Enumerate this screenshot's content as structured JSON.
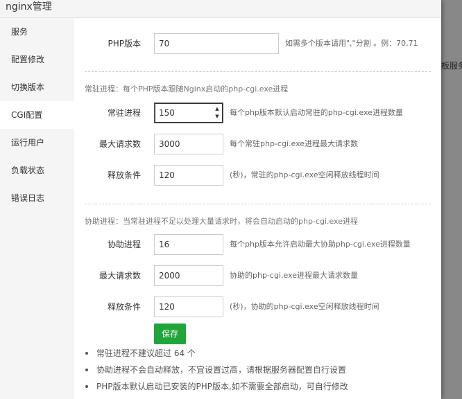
{
  "window": {
    "title": "nginx管理"
  },
  "background": {
    "right_text": "板服务"
  },
  "sidebar": {
    "items": [
      {
        "label": "服务",
        "active": false
      },
      {
        "label": "配置修改",
        "active": false
      },
      {
        "label": "切换版本",
        "active": false
      },
      {
        "label": "CGI配置",
        "active": true
      },
      {
        "label": "运行用户",
        "active": false
      },
      {
        "label": "负载状态",
        "active": false
      },
      {
        "label": "错误日志",
        "active": false
      }
    ]
  },
  "php_version": {
    "label": "PHP版本",
    "value": "70",
    "hint": "如需多个版本请用\",\"分割 。例：70,71"
  },
  "resident_section": {
    "title": "常驻进程：每个PHP版本跟随Nginx启动的php-cgi.exe进程",
    "fields": [
      {
        "label": "常驻进程",
        "value": "150",
        "hint": "每个php版本默认启动常驻的php-cgi.exe进程数量"
      },
      {
        "label": "最大请求数",
        "value": "3000",
        "hint": "每个常驻php-cgi.exe进程最大请求数"
      },
      {
        "label": "释放条件",
        "value": "120",
        "hint": "(秒)，常驻的php-cgi.exe空闲释放线程时间"
      }
    ]
  },
  "helper_section": {
    "title": "协助进程：当常驻进程不足以处理大量请求时，将会自动启动的php-cgi.exe进程",
    "fields": [
      {
        "label": "协助进程",
        "value": "16",
        "hint": "每个php版本允许启动最大协助php-cgi.exe进程数量"
      },
      {
        "label": "最大请求数",
        "value": "2000",
        "hint": "协助的php-cgi.exe进程最大请求数量"
      },
      {
        "label": "释放条件",
        "value": "120",
        "hint": "(秒)，协助的php-cgi.exe空闲释放线程时间"
      }
    ]
  },
  "save_label": "保存",
  "notes": [
    "常驻进程不建议超过 64 个",
    "协助进程不会自动释放，不宜设置过高，请根据服务器配置自行设置",
    "PHP版本默认启动已安装的PHP版本,如不需要全部启动，可自行修改"
  ],
  "colors": {
    "accent": "#20a53a",
    "sidebar_bg": "#f5f5f5"
  }
}
